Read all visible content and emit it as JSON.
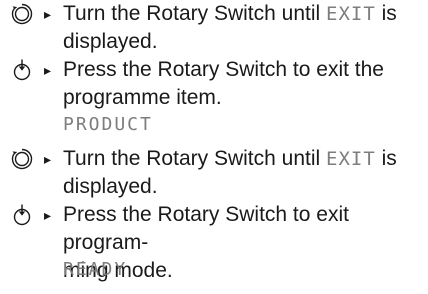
{
  "steps": [
    {
      "icon": "rotary-turn-icon",
      "marker": "▸",
      "text_before": "Turn the Rotary Switch until ",
      "display_code": "EXIT",
      "text_after": " is\ndisplayed."
    },
    {
      "icon": "rotary-press-icon",
      "marker": "▸",
      "text": "Press the Rotary Switch to exit the\nprogramme item.",
      "display_result": "PRODUCT"
    },
    {
      "icon": "rotary-turn-icon",
      "marker": "▸",
      "text_before": "Turn the Rotary Switch until ",
      "display_code": "EXIT",
      "text_after": " is\ndisplayed."
    },
    {
      "icon": "rotary-press-icon",
      "marker": "▸",
      "text": "Press the Rotary Switch to exit program-\nming mode.",
      "display_result": "READY"
    }
  ]
}
